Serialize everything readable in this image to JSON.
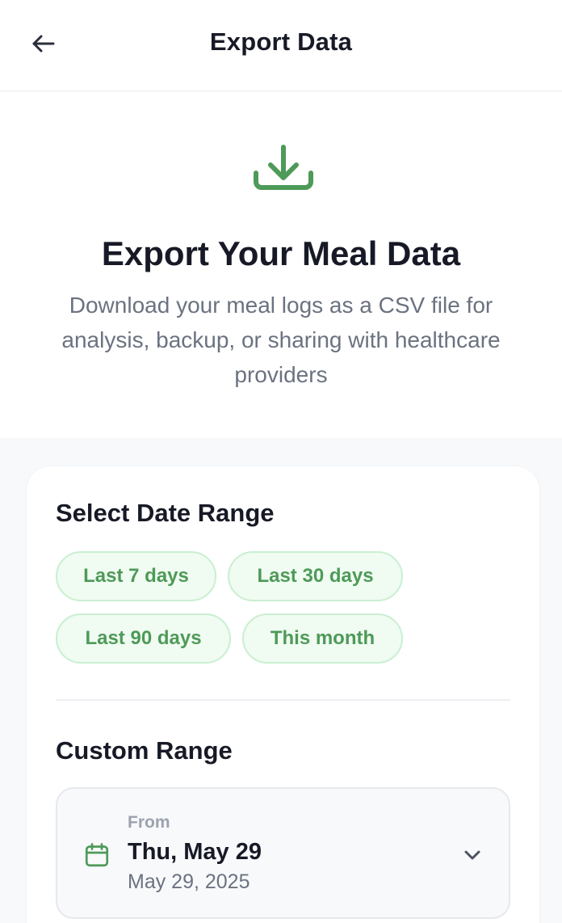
{
  "header": {
    "title": "Export Data",
    "back_icon": "arrow-left-icon"
  },
  "hero": {
    "icon": "download-icon",
    "title": "Export Your Meal Data",
    "description": "Download your meal logs as a CSV file for analysis, backup, or sharing with healthcare providers"
  },
  "date_range": {
    "title": "Select Date Range",
    "presets": [
      "Last 7 days",
      "Last 30 days",
      "Last 90 days",
      "This month"
    ]
  },
  "custom_range": {
    "title": "Custom Range",
    "from": {
      "label": "From",
      "date_display": "Thu, May 29",
      "date_full": "May 29, 2025",
      "icon": "calendar-icon"
    }
  },
  "colors": {
    "accent": "#4e9a58",
    "chip_bg": "#f0fbf2",
    "chip_border": "#c9efd1",
    "text_primary": "#171a26",
    "text_secondary": "#6b7280",
    "page_bg": "#f8f9fb"
  }
}
